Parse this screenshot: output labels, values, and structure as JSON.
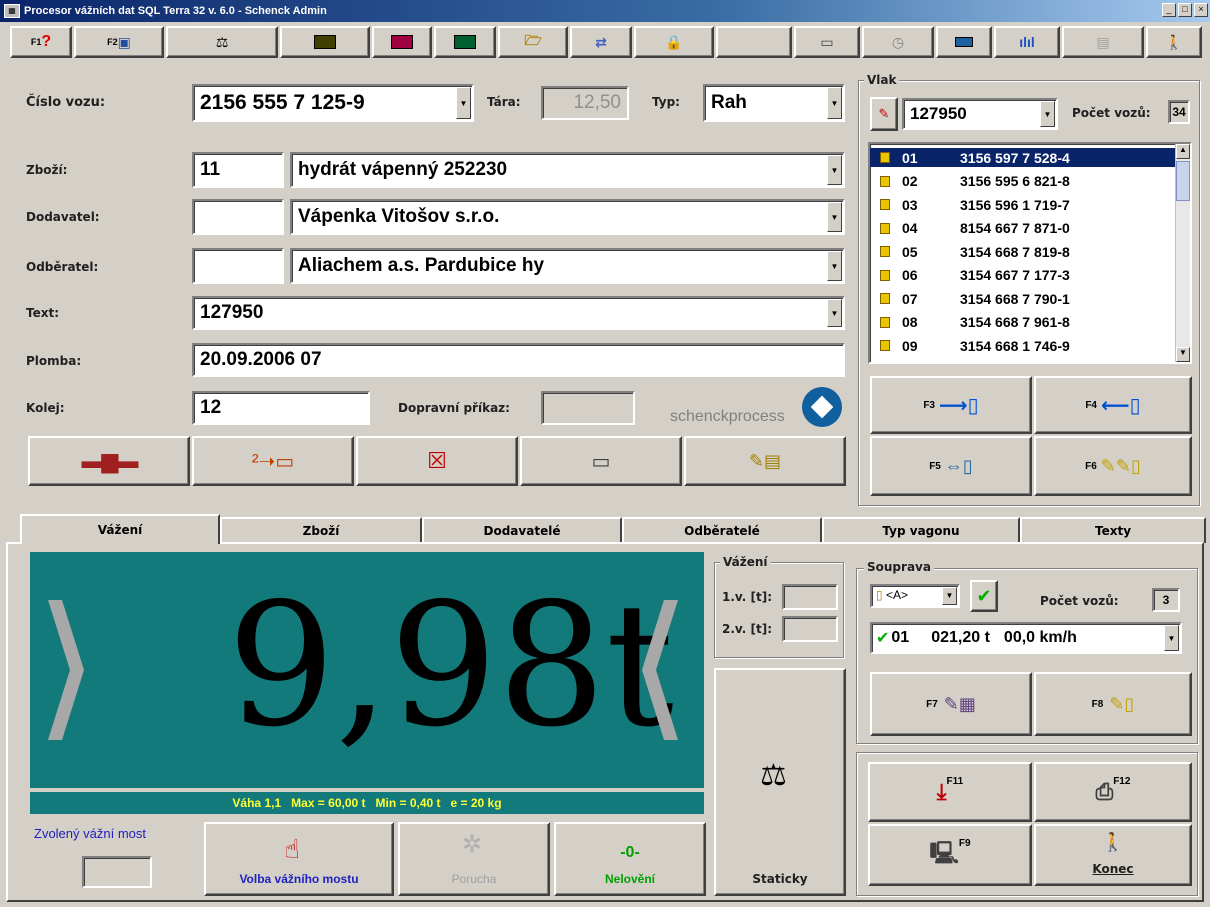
{
  "window": {
    "title": "Procesor vážních dat SQL Terra 32 v. 6.0 - Schenck Admin"
  },
  "toolbar": {
    "f1_label": "F1",
    "f2_label": "F2",
    "buttons": [
      "help-icon",
      "calendar-icon",
      "scale-icon",
      "chart-a-icon",
      "chart-b-icon",
      "chart-c-icon",
      "folder-open-icon",
      "transfer-icon",
      "lock-icon",
      "blank",
      "train-icon",
      "clock-icon",
      "keyboard-icon",
      "bar-chart-icon",
      "disabled-icon",
      "exit-icon"
    ]
  },
  "form": {
    "wagon_number_label": "Číslo vozu:",
    "wagon_number_value": "2156 555 7 125-9",
    "tara_label": "Tára:",
    "tara_value": "12,50",
    "type_label": "Typ:",
    "type_value": "Rah",
    "goods_label": "Zboží:",
    "goods_code": "11",
    "goods_name": "hydrát vápenný 252230",
    "supplier_label": "Dodavatel:",
    "supplier_code": "",
    "supplier_name": "Vápenka Vitošov s.r.o.",
    "customer_label": "Odběratel:",
    "customer_code": "",
    "customer_name": "Aliachem a.s. Pardubice hy",
    "text_label": "Text:",
    "text_value": "127950",
    "seal_label": "Plomba:",
    "seal_value": "20.09.2006 07",
    "track_label": "Kolej:",
    "track_value": "12",
    "transport_order_label": "Dopravní příkaz:",
    "transport_order_value": "",
    "logo_text": "schenckprocess"
  },
  "train": {
    "group_label": "Vlak",
    "train_number": "127950",
    "wagon_count_label": "Počet vozů:",
    "wagon_count": "34",
    "wagons": [
      {
        "pos": "01",
        "number": "3156 597 7 528-4"
      },
      {
        "pos": "02",
        "number": "3156 595 6 821-8"
      },
      {
        "pos": "03",
        "number": "3156 596 1 719-7"
      },
      {
        "pos": "04",
        "number": "8154 667 7 871-0"
      },
      {
        "pos": "05",
        "number": "3154 668 7 819-8"
      },
      {
        "pos": "06",
        "number": "3154 667 7 177-3"
      },
      {
        "pos": "07",
        "number": "3154 668 7 790-1"
      },
      {
        "pos": "08",
        "number": "3154 668 7 961-8"
      },
      {
        "pos": "09",
        "number": "3154 668 1 746-9"
      }
    ],
    "f3": "F3",
    "f4": "F4",
    "f5": "F5",
    "f6": "F6"
  },
  "tabs": [
    "Vážení",
    "Zboží",
    "Dodavatelé",
    "Odběratelé",
    "Typ vagonu",
    "Texty"
  ],
  "weighing": {
    "display_value": "9,98t",
    "scale_info": "Váha 1,1   Max = 60,00 t   Min = 0,40 t   e = 20 kg",
    "group_label": "Vážení",
    "v1_label": "1.v. [t]:",
    "v2_label": "2.v. [t]:",
    "selected_bridge_label": "Zvolený vážní most",
    "btn_select_bridge": "Volba vážního mostu",
    "btn_fault": "Porucha",
    "btn_no_weighing_glyph": "-0-",
    "btn_no_weighing": "Nelovění",
    "btn_static": "Staticky"
  },
  "set": {
    "group_label": "Souprava",
    "selector_value": "<A>",
    "wagon_count_label": "Počet vozů:",
    "wagon_count": "3",
    "row_pos": "01",
    "row_weight": "021,20 t",
    "row_speed": "00,0 km/h",
    "f7": "F7",
    "f8": "F8"
  },
  "actions": {
    "f11": "F11",
    "f12": "F12",
    "f9": "F9",
    "exit_label": "Konec"
  },
  "colors": {
    "display_bg": "#127a7a",
    "info_text": "#ffff33",
    "selection": "#0a246a",
    "green": "#00a000"
  }
}
